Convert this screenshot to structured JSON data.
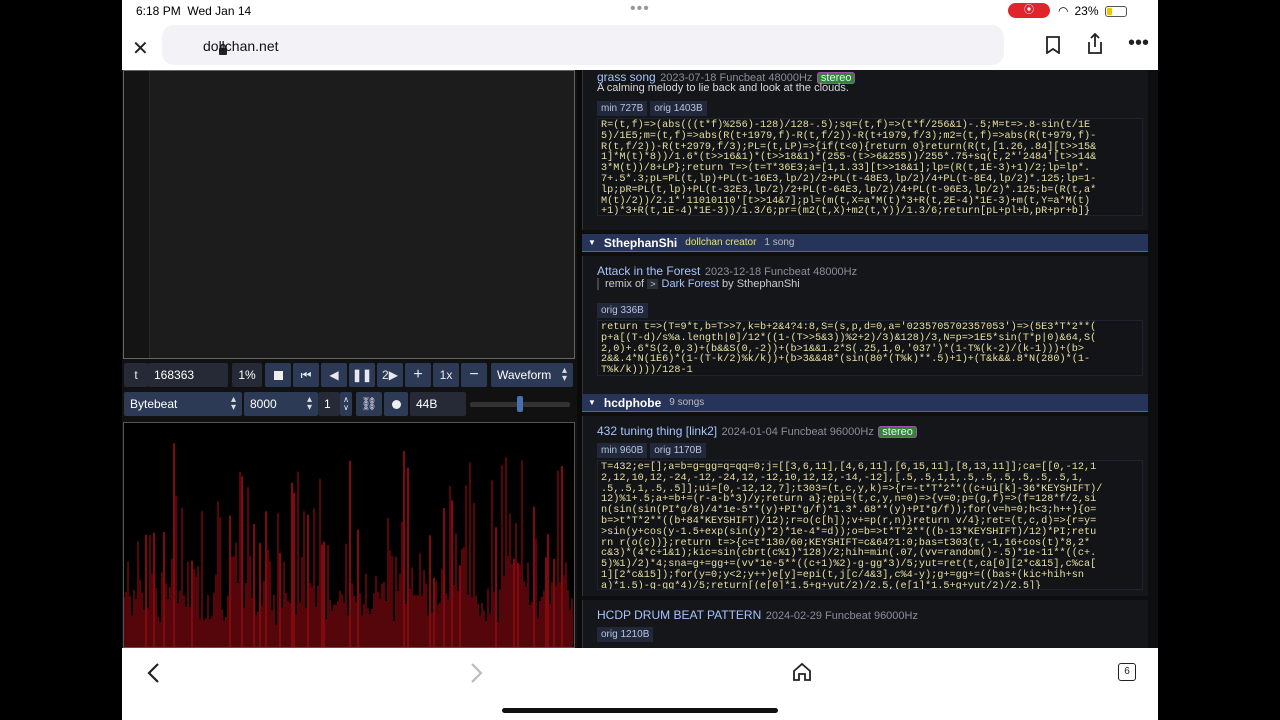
{
  "status": {
    "time": "6:18 PM",
    "date": "Wed Jan 14",
    "battery": "23%"
  },
  "browser": {
    "url": "dollchan.net",
    "tabs_count": "6"
  },
  "player": {
    "t_label": "t",
    "t_value": "168363",
    "percent": "1%",
    "speed": "2",
    "rate_mult": "1x",
    "view_mode": "Waveform",
    "mode": "Bytebeat",
    "sample_rate": "8000",
    "divisor": "1",
    "size": "44B",
    "volume": 0.65
  },
  "library": {
    "song1": {
      "title": "grass song",
      "meta": "2023-07-18 Funcbeat 48000Hz",
      "stereo": "stereo",
      "description": "A calming melody to lie back and look at the clouds.",
      "tags": [
        "min 727B",
        "orig 1403B"
      ],
      "code": "R=(t,f)=>(abs(((t*f)%256)-128)/128-.5);sq=(t,f)=>(t*f/256&1)-.5;M=t=>.8-sin(t/1E\n5)/1E5;m=(t,f)=>abs(R(t+1979,f)-R(t,f/2))-R(t+1979,f/3);m2=(t,f)=>abs(R(t+979,f)-\nR(t,f/2))-R(t+2979,f/3);PL=(t,LP)=>{if(t<0){return 0}return(R(t,[1.26,.84][t>>15&\n1]*M(t)*8))/1.6*(t>>16&1)*(t>>18&1)*(255-(t>>6&255))/255*.75+sq(t,2*'2484'[t>>14&\n3*M(t))/8+LP};return T=>(t=T*36E3;a=[1,1.33][t>>18&1];lp=(R(t,1E-3)+1)/2;lp=lp*.\n7+.5*.3;pL=PL(t,lp)+PL(t-16E3,lp/2)/2+PL(t-48E3,lp/2)/4+PL(t-8E4,lp/2)*.125;lp=1-\nlp;pR=PL(t,lp)+PL(t-32E3,lp/2)/2+PL(t-64E3,lp/2)/4+PL(t-96E3,lp/2)*.125;b=(R(t,a*\nM(t)/2))/2.1*'11010110'[t>>14&7];pl=(m(t,X=a*M(t)*3+R(t,2E-4)*1E-3)+m(t,Y=a*M(t)\n+1)*3+R(t,1E-4)*1E-3))/1.3/6;pr=(m2(t,X)+m2(t,Y))/1.3/6;return[pL+pl+b,pR+pr+b]}"
    },
    "author1": {
      "name": "SthephanShi",
      "role": "dollchan creator",
      "count": "1 song"
    },
    "song2": {
      "title": "Attack in the Forest",
      "meta": "2023-12-18 Funcbeat 48000Hz",
      "remix_prefix": "remix of",
      "remix_arrow": ">",
      "remix_title": "Dark Forest",
      "remix_by": "by SthephanShi",
      "tags": [
        "orig 336B"
      ],
      "code": "return t=>(T=9*t,b=T>>7,k=b+2&4?4:8,S=(s,p,d=0,a='0235705702357053')=>(5E3*T*2**(\np+a[(T-d)/s%a.length|0]/12*((1-(T>>5&3))%2+2)/3)&128)/3,N=p=>1E5*sin(T*p|0)&64,S(\n2,0)+.6*S(2,0,3)+(b&&S(0,-2))+(b>1&&1.2*S(.25,1,0,'037')*(1-T%(k-2)/(k-1)))+(b>\n2&&.4*N(1E6)*(1-(T-k/2)%k/k))+(b>3&&48*(sin(80*(T%k)**.5)+1)+(T&k&&.8*N(280)*(1-\nT%k/k))))/128-1"
    },
    "author2": {
      "name": "hcdphobe",
      "count": "9 songs"
    },
    "song3": {
      "title": "432 tuning thing [link2]",
      "meta": "2024-01-04 Funcbeat 96000Hz",
      "stereo": "stereo",
      "tags": [
        "min 960B",
        "orig 1170B"
      ],
      "code": "T=432;e=[];a=b=g=gg=q=qq=0;j=[[3,6,11],[4,6,11],[6,15,11],[8,13,11]];ca=[[0,-12,1\n2,12,10,12,-24,-12,-24,12,-12,10,12,12,-14,-12],[.5,.5,1,1,.5,.5,.5,.5,.5,.5,1,\n.5,.5,1,.5,.5]];ui=[0,-12,12,7];t303=(t,c,y,k)=>{r=-t*T*2**((c+ui[k]-36*KEYSHIFT)/\n12)%1+.5;a+=b+=(r-a-b*3)/y;return a};epi=(t,c,y,n=0)=>{v=0;p=(g,f)=>(f=128*f/2,si\nn(sin(sin(PI*g/8)/4*1e-5**(y)+PI*g/f)*1.3*.68**(y)+PI*g/f));for(v=h=0;h<3;h++){o=\nb=>t*T*2**((b+84*KEYSHIFT)/12);r=o(c[h]);v+=p(r,n)}return v/4};ret=(t,c,d)=>{r=y=\n>sin(y+cos(y-1.5+exp(sin(y)*2)*1e-4*=d));o=b=>t*T*2**((b-13*KEYSHIFT)/12)*PI;retu\nrn r(o(c))};return t=>{c=t*130/60;KEYSHIFT=c&64?1:0;bas=t303(t,-1,16+cos(t)*8,2*\nc&3)*(4*c+1&1);kic=sin(cbrt(c%1)*128)/2;hih=min(.07,(vv=random()-.5)*1e-11**((c+.\n5)%1)/2)*4;sna=g+=gg+=(vv*1e-5**((c+1)%2)-g-gg*3)/5;yut=ret(t,ca[0][2*c&15],c%ca[\n1][2*c&15]);for(y=0;y<2;y++)e[y]=epi(t,j[c/4&3],c%4-y);g+=gg+=((bas+(kic+hih+sn\na)*1.5)-g-gg*4)/5;return[(e[0]*1.5+g+yut/2)/2.5,(e[1]*1.5+g+yut/2)/2.5]}"
    },
    "song4": {
      "title": "HCDP DRUM BEAT PATTERN",
      "meta": "2024-02-29 Funcbeat 96000Hz",
      "tags": [
        "orig 1210B"
      ]
    }
  }
}
